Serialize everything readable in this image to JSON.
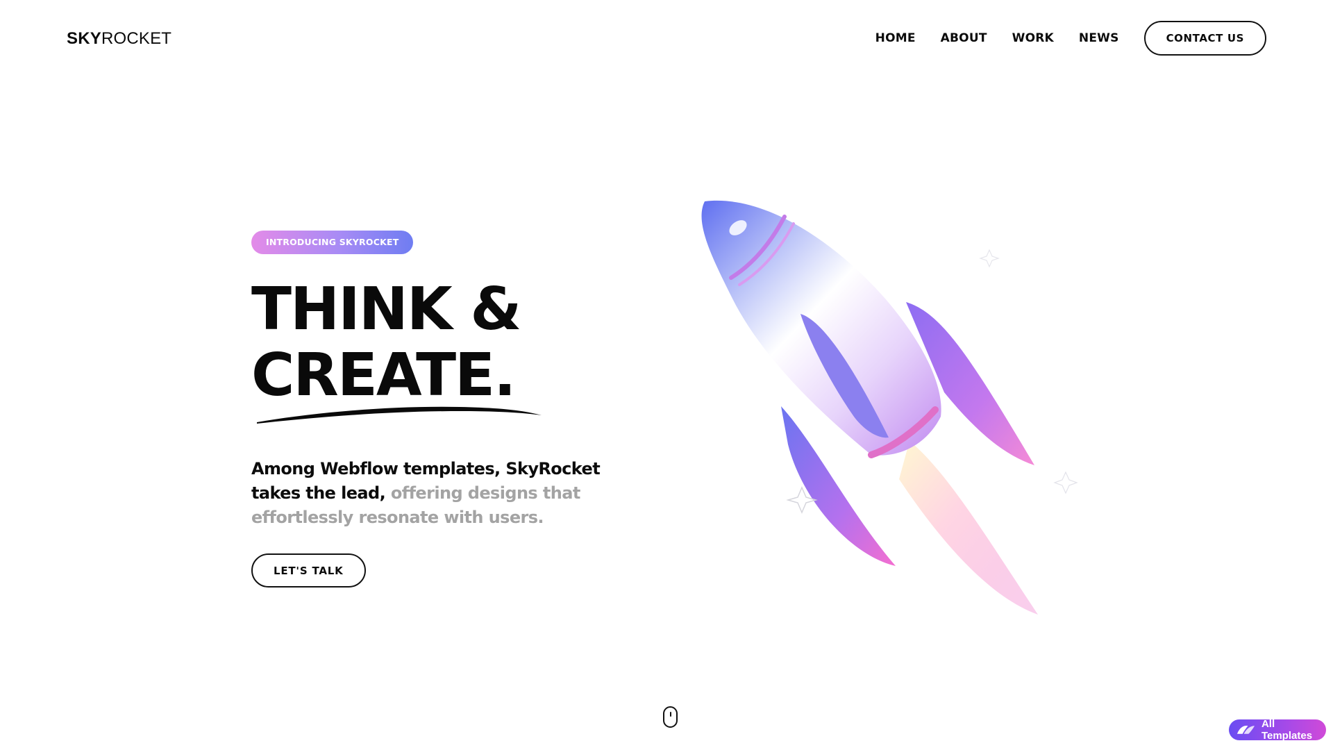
{
  "header": {
    "logo_bold": "SKY",
    "logo_light": "ROCKET",
    "nav": [
      {
        "label": "HOME"
      },
      {
        "label": "ABOUT"
      },
      {
        "label": "WORK"
      },
      {
        "label": "NEWS"
      }
    ],
    "cta_label": "CONTACT US"
  },
  "hero": {
    "badge": "INTRODUCING SKYROCKET",
    "headline_line1": "THINK &",
    "headline_line2": "CREATE.",
    "body_strong": "Among Webflow templates, SkyRocket takes the lead,",
    "body_muted": "offering designs that effortlessly resonate with users.",
    "button_label": "LET'S TALK"
  },
  "floating": {
    "all_templates_label": "All Templates"
  },
  "colors": {
    "badge_gradient": [
      "#e38be8",
      "#6f7df2"
    ],
    "text_muted": "#a3a3a3",
    "pill_gradient": [
      "#6a4cf2",
      "#d04ad8"
    ]
  },
  "icons": [
    "rocket-illustration",
    "scroll-mouse-icon",
    "templates-logo-icon"
  ]
}
